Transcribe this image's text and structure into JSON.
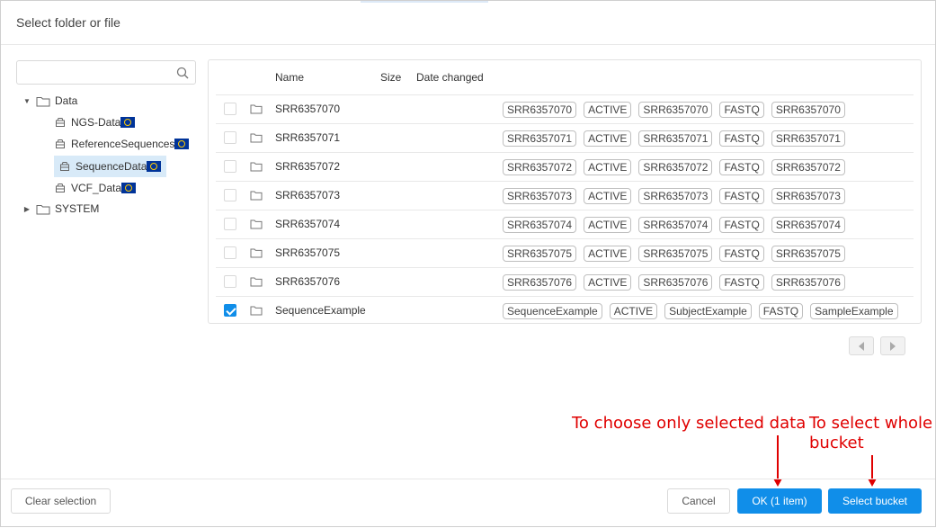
{
  "dialog": {
    "title": "Select folder or file"
  },
  "tree": {
    "search_placeholder": "",
    "nodes": [
      {
        "label": "Data",
        "expanded": true
      },
      {
        "label": "NGS-Data"
      },
      {
        "label": "ReferenceSequences"
      },
      {
        "label": "SequenceData",
        "selected": true
      },
      {
        "label": "VCF_Data"
      },
      {
        "label": "SYSTEM",
        "expanded": false
      }
    ]
  },
  "table": {
    "columns": [
      "Name",
      "Size",
      "Date changed"
    ],
    "rows": [
      {
        "name": "SRR6357070",
        "checked": false,
        "tags": [
          "SRR6357070",
          "ACTIVE",
          "SRR6357070",
          "FASTQ",
          "SRR6357070"
        ]
      },
      {
        "name": "SRR6357071",
        "checked": false,
        "tags": [
          "SRR6357071",
          "ACTIVE",
          "SRR6357071",
          "FASTQ",
          "SRR6357071"
        ]
      },
      {
        "name": "SRR6357072",
        "checked": false,
        "tags": [
          "SRR6357072",
          "ACTIVE",
          "SRR6357072",
          "FASTQ",
          "SRR6357072"
        ]
      },
      {
        "name": "SRR6357073",
        "checked": false,
        "tags": [
          "SRR6357073",
          "ACTIVE",
          "SRR6357073",
          "FASTQ",
          "SRR6357073"
        ]
      },
      {
        "name": "SRR6357074",
        "checked": false,
        "tags": [
          "SRR6357074",
          "ACTIVE",
          "SRR6357074",
          "FASTQ",
          "SRR6357074"
        ]
      },
      {
        "name": "SRR6357075",
        "checked": false,
        "tags": [
          "SRR6357075",
          "ACTIVE",
          "SRR6357075",
          "FASTQ",
          "SRR6357075"
        ]
      },
      {
        "name": "SRR6357076",
        "checked": false,
        "tags": [
          "SRR6357076",
          "ACTIVE",
          "SRR6357076",
          "FASTQ",
          "SRR6357076"
        ]
      },
      {
        "name": "SequenceExample",
        "checked": true,
        "tags": [
          "SequenceExample",
          "ACTIVE",
          "SubjectExample",
          "FASTQ",
          "SampleExample"
        ]
      }
    ]
  },
  "annotations": {
    "ok_note": "To choose only selected data",
    "bucket_note_line1": "To select whole",
    "bucket_note_line2": "bucket",
    "color": "#e00000"
  },
  "footer": {
    "clear_label": "Clear selection",
    "cancel_label": "Cancel",
    "ok_label": "OK (1 item)",
    "select_bucket_label": "Select bucket"
  },
  "colors": {
    "primary": "#108ee9",
    "selected_bg": "#d8eaf8",
    "region_flag": "#003399"
  },
  "icons": {
    "search": "search-icon",
    "folder": "folder-icon",
    "bucket": "bucket-icon",
    "region": "eu-flag-icon"
  }
}
